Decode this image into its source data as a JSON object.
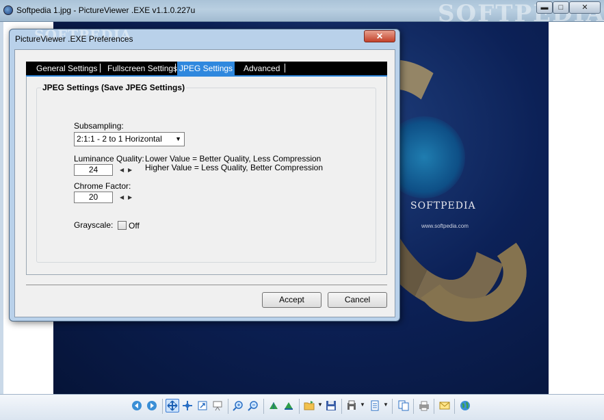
{
  "window": {
    "title": "Softpedia 1.jpg - PictureViewer .EXE v1.1.0.227u",
    "watermark": "SOFTPEDIA",
    "controls": {
      "minimize": "▬",
      "maximize": "□",
      "close": "✕"
    }
  },
  "image": {
    "logo": "SOFTPEDIA",
    "url": "www.softpedia.com"
  },
  "dialog": {
    "title": "PictureViewer .EXE Preferences",
    "watermark": "SOFTPEDIA",
    "close": "✕",
    "tabs": [
      {
        "label": "General Settings",
        "active": false
      },
      {
        "label": "Fullscreen Settings",
        "active": false
      },
      {
        "label": "JPEG Settings",
        "active": true
      },
      {
        "label": "Advanced",
        "active": false
      }
    ],
    "group_title": "JPEG Settings (Save JPEG Settings)",
    "subsampling": {
      "label": "Subsampling:",
      "value": "2:1:1 - 2 to 1 Horizontal"
    },
    "luminance": {
      "label": "Luminance Quality:",
      "value": "24",
      "hint1": "Lower Value = Better Quality, Less Compression",
      "hint2": "Higher Value = Less Quality, Better Compression"
    },
    "chrome": {
      "label": "Chrome Factor:",
      "value": "20"
    },
    "grayscale": {
      "label": "Grayscale:",
      "state": "Off"
    },
    "accept": "Accept",
    "cancel": "Cancel"
  },
  "toolbar": {
    "icons": [
      "back-icon",
      "forward-icon",
      "fit-icon",
      "move-icon",
      "actual-size-icon",
      "slideshow-icon",
      "zoom-in-icon",
      "zoom-out-icon",
      "rotate-left-icon",
      "rotate-right-icon",
      "open-folder-icon",
      "save-icon",
      "print-setup-icon",
      "page-icon",
      "copy-icon",
      "printer-icon",
      "email-icon",
      "web-icon"
    ]
  },
  "colors": {
    "accent": "#2f88de",
    "titlebar": "#b9d1ea",
    "image_bg": "#0c2157"
  }
}
